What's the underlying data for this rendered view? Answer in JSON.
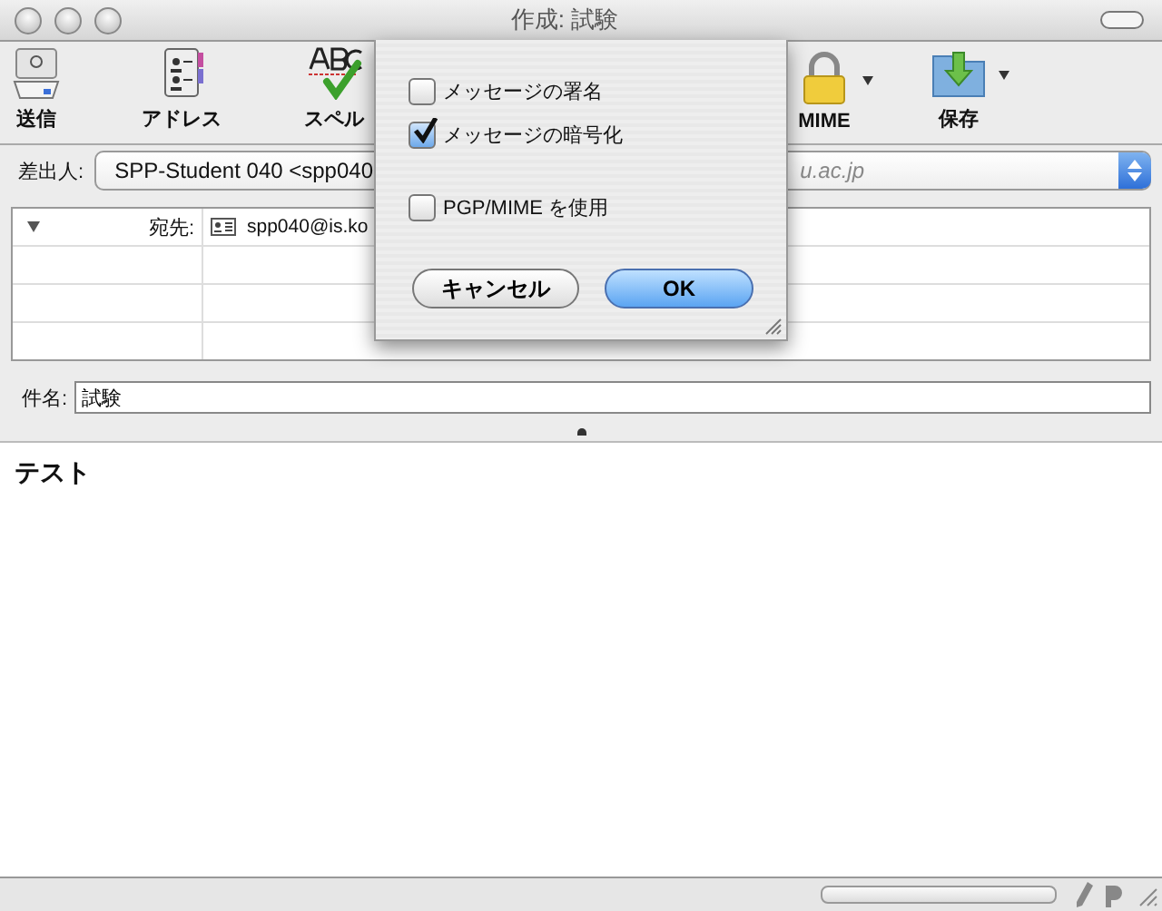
{
  "window": {
    "title": "作成: 試験"
  },
  "toolbar": [
    {
      "kind": "send",
      "label": "送信",
      "menu": false
    },
    {
      "kind": "address",
      "label": "アドレス",
      "menu": false
    },
    {
      "kind": "spell",
      "label": "スペル"
    },
    {
      "kind": "lock",
      "label": "MIME",
      "menu": true
    },
    {
      "kind": "save",
      "label": "保存",
      "menu": true
    }
  ],
  "from": {
    "label": "差出人:",
    "value": "SPP-Student 040 <spp040",
    "account": "u.ac.jp"
  },
  "recipients": [
    {
      "label": "宛先:",
      "address": "spp040@is.ko"
    }
  ],
  "subject": {
    "label": "件名:",
    "value": "試験"
  },
  "body": "テスト",
  "status": {
    "progress": {
      "level": 0
    }
  },
  "sheet": {
    "options": [
      {
        "label": "メッセージの署名",
        "checked": false
      },
      {
        "label": "メッセージの暗号化",
        "checked": true
      },
      {
        "label": "PGP/MIME を使用",
        "checked": false
      }
    ],
    "buttons": [
      {
        "label": "キャンセル",
        "default": false
      },
      {
        "label": "OK",
        "default": true
      }
    ]
  }
}
